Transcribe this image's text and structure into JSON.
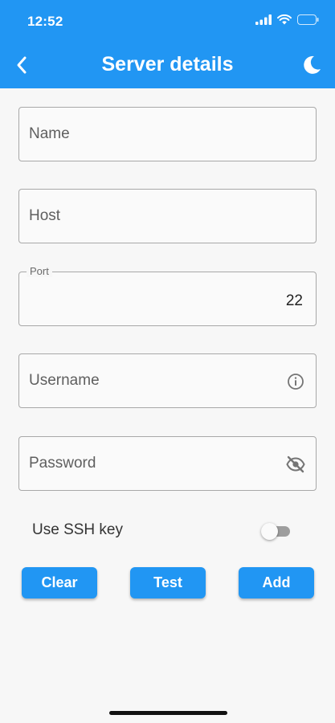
{
  "status_bar": {
    "time": "12:52"
  },
  "appbar": {
    "title": "Server details",
    "back_icon": "chevron-left-icon",
    "theme_icon": "moon-icon"
  },
  "form": {
    "name": {
      "placeholder": "Name",
      "value": ""
    },
    "host": {
      "placeholder": "Host",
      "value": ""
    },
    "port": {
      "label": "Port",
      "value": "22"
    },
    "username": {
      "placeholder": "Username",
      "value": "",
      "icon": "info-icon"
    },
    "password": {
      "placeholder": "Password",
      "value": "",
      "icon": "visibility-off-icon"
    },
    "ssh_key": {
      "label": "Use SSH key",
      "enabled": false
    }
  },
  "buttons": {
    "clear": "Clear",
    "test": "Test",
    "add": "Add"
  },
  "colors": {
    "primary": "#2196f3",
    "background": "#f7f7f7",
    "border": "#a8a8a8"
  }
}
